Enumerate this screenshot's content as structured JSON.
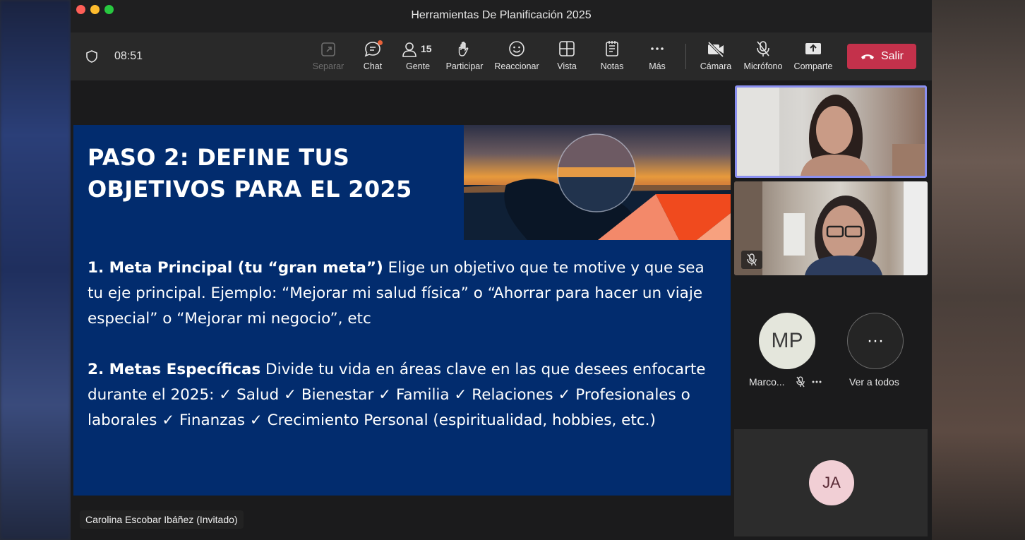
{
  "window": {
    "title": "Herramientas De Planificación 2025"
  },
  "toolbar": {
    "time": "08:51",
    "people_count": "15",
    "buttons": {
      "separar": "Separar",
      "chat": "Chat",
      "gente": "Gente",
      "participar": "Participar",
      "reaccionar": "Reaccionar",
      "vista": "Vista",
      "notas": "Notas",
      "mas": "Más",
      "camara": "Cámara",
      "microfono": "Micrófono",
      "compartir": "Comparte",
      "salir": "Salir"
    }
  },
  "slide": {
    "title_line1": "PASO 2: DEFINE TUS",
    "title_line2": "OBJETIVOS PARA EL 2025",
    "item1_heading": "1. Meta Principal (tu “gran meta”)",
    "item1_text": " Elige un objetivo que te motive y que sea tu eje principal. Ejemplo: “Mejorar mi salud física” o “Ahorrar para hacer un viaje especial” o “Mejorar mi negocio”, etc",
    "item2_heading": "2. Metas Específicas",
    "item2_text": " Divide tu vida en áreas clave en las que desees enfocarte durante el 2025: ✓ Salud ✓ Bienestar ✓ Familia ✓ Relaciones ✓ Profesionales o laborales ✓ Finanzas ✓ Crecimiento Personal (espiritualidad, hobbies, etc.)"
  },
  "presenter": {
    "name": "Carolina Escobar Ibáñez (Invitado)"
  },
  "participants": {
    "mp_initials": "MP",
    "mp_name": "Marco...",
    "see_all": "Ver a todos",
    "ja_initials": "JA",
    "more_glyph": "···"
  },
  "colors": {
    "slide_bg": "#022c6e",
    "leave": "#c4314b",
    "speaker_border": "#8a8ff0",
    "accent_orange": "#f04a1e"
  }
}
